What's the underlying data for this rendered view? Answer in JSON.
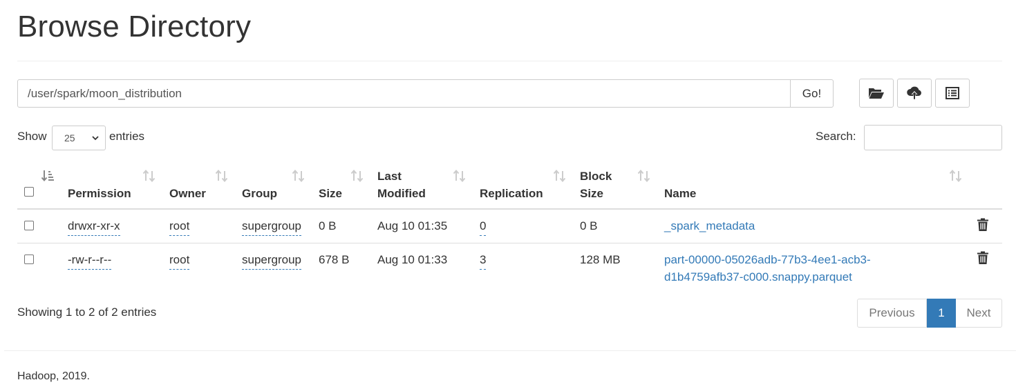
{
  "page": {
    "title": "Browse Directory"
  },
  "path_bar": {
    "value": "/user/spark/moon_distribution",
    "go_label": "Go!",
    "tools": [
      {
        "icon": "folder-open-icon"
      },
      {
        "icon": "cloud-upload-icon"
      },
      {
        "icon": "list-alt-icon"
      }
    ]
  },
  "table_controls": {
    "show_label": "Show",
    "page_length": "25",
    "entries_label": "entries",
    "search_label": "Search:"
  },
  "columns": {
    "permission": "Permission",
    "owner": "Owner",
    "group": "Group",
    "size": "Size",
    "last_modified_1": "Last",
    "last_modified_2": "Modified",
    "replication": "Replication",
    "block_size_1": "Block",
    "block_size_2": "Size",
    "name": "Name"
  },
  "rows": [
    {
      "permission": "drwxr-xr-x",
      "owner": "root",
      "group": "supergroup",
      "size": "0 B",
      "last_modified": "Aug 10 01:35",
      "replication": "0",
      "block_size": "0 B",
      "name_line1": "_spark_metadata",
      "name_line2": ""
    },
    {
      "permission": "-rw-r--r--",
      "owner": "root",
      "group": "supergroup",
      "size": "678 B",
      "last_modified": "Aug 10 01:33",
      "replication": "3",
      "block_size": "128 MB",
      "name_line1": "part-00000-05026adb-77b3-4ee1-acb3-",
      "name_line2": "d1b4759afb37-c000.snappy.parquet"
    }
  ],
  "info": "Showing 1 to 2 of 2 entries",
  "pagination": {
    "previous": "Previous",
    "current": "1",
    "next": "Next"
  },
  "footer": "Hadoop, 2019.",
  "colors": {
    "link": "#337ab7",
    "accent": "#337ab7",
    "border": "#cccccc"
  }
}
